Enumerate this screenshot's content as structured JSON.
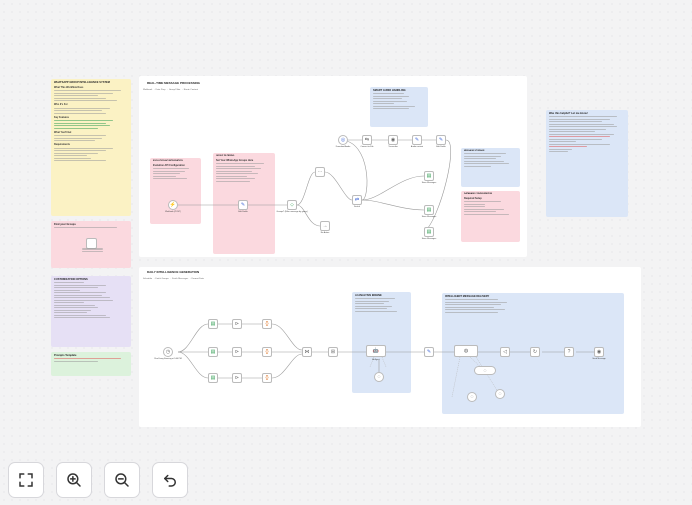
{
  "sections": {
    "realtime": {
      "title": "REAL-TIME MESSAGE PROCESSING",
      "subtitle": "Webhook → Data Prep → Group Filter → Route Content"
    },
    "daily": {
      "title": "DAILY INTELLIGENCE GENERATION",
      "subtitle": "Schedule → Fetch Groups → Fetch Messages → Format Data"
    }
  },
  "notes": {
    "intro": {
      "title": "WHATSAPP GROUP INTELLIGENCE SYSTEM",
      "h1": "What This Workflow Does",
      "h2": "Who It's For",
      "h3": "Key Features",
      "h4": "What You'll Get",
      "h5": "Requirements"
    },
    "find_groups": {
      "title": "Find your Groups"
    },
    "customization": {
      "title": "CUSTOMIZATION OPTIONS"
    },
    "prompts": {
      "title": "Prompts Template"
    },
    "evolution": {
      "title": "EVOLUTION API INTEGRATION",
      "h1": "Evolution API Configuration"
    },
    "group_filter": {
      "title": "GROUP FILTERING",
      "h1": "Set Your WhatsApp Groups Here"
    },
    "audio": {
      "title": "SMART AUDIO HANDLING"
    },
    "storage": {
      "title": "MESSAGE STORAGE"
    },
    "database": {
      "title": "DATABASE CONFIGURATION",
      "h1": "Required Setup"
    },
    "ai_engine": {
      "title": "AI ANALYSIS ENGINE"
    },
    "delivery": {
      "title": "INTELLIGENT MESSAGE DELIVERY"
    },
    "help": {
      "title": "Was this helpful? Let me know!"
    }
  },
  "nodes": {
    "webhook": "Webhook (POST)",
    "set_data": "Edit Fields",
    "group_check": "Groups? (Filter message by group)",
    "no_action": "No Action",
    "switch": "Switch",
    "audio_download": "Download Audio",
    "convert": "Convert to File",
    "transcribe": "Transcribe",
    "audio_output": "Audio content",
    "edit_text": "Edit Fields",
    "store1": "Store Messages",
    "store2": "Store Messages",
    "store3": "Store Messages",
    "schedule": "Run Every Evening at 9:00 PM",
    "ai_agent": "AI Agent",
    "send": "Send Message"
  },
  "toolbar": {
    "fit_icon": "fit-view-icon",
    "zoom_in_icon": "zoom-in-icon",
    "zoom_out_icon": "zoom-out-icon",
    "undo_icon": "undo-icon"
  },
  "colors": {
    "yellow": "#fbf2c4",
    "pink": "#fbd9df",
    "blue": "#dbe6f7",
    "purple": "#e6e0f5",
    "green": "#dcf2dc"
  }
}
